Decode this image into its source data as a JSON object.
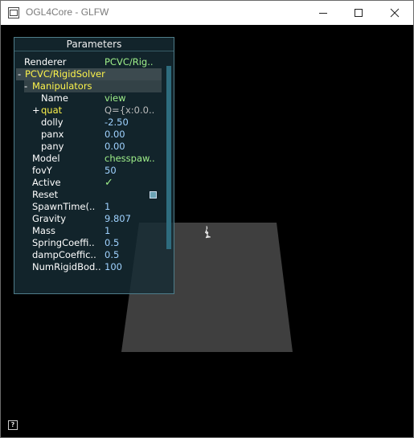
{
  "window": {
    "title": "OGL4Core - GLFW",
    "controls": {
      "minimize_icon": "minimize-icon",
      "maximize_icon": "maximize-icon",
      "close_icon": "close-icon"
    }
  },
  "panel": {
    "title": "Parameters",
    "renderer": {
      "label": "Renderer",
      "value": "PCVC/Rig.."
    },
    "group": {
      "toggle": "-",
      "label": "PCVC/RigidSolver"
    },
    "subgroup": {
      "toggle": "-",
      "label": "Manipulators"
    },
    "manipulators": [
      {
        "toggle": "",
        "label": "Name",
        "value": "view",
        "label_color": "white",
        "value_color": "green"
      },
      {
        "toggle": "+",
        "label": "quat",
        "value": "Q={x:0.0..",
        "label_color": "yellow",
        "value_color": "grey"
      },
      {
        "toggle": "",
        "label": "dolly",
        "value": "-2.50",
        "label_color": "white",
        "value_color": "blue"
      },
      {
        "toggle": "",
        "label": "panx",
        "value": "0.00",
        "label_color": "white",
        "value_color": "blue"
      },
      {
        "toggle": "",
        "label": "pany",
        "value": "0.00",
        "label_color": "white",
        "value_color": "blue"
      }
    ],
    "params": [
      {
        "label": "Model",
        "value": "chesspaw.."
      },
      {
        "label": "fovY",
        "value": "50"
      },
      {
        "label": "Active",
        "value": "✓"
      },
      {
        "label": "Reset",
        "value": ""
      },
      {
        "label": "SpawnTime(..",
        "value": "1"
      },
      {
        "label": "Gravity",
        "value": "9.807"
      },
      {
        "label": "Mass",
        "value": "1"
      },
      {
        "label": "SpringCoeffi..",
        "value": "0.5"
      },
      {
        "label": "dampCoeffic..",
        "value": "0.5"
      },
      {
        "label": "NumRigidBod..",
        "value": "100"
      }
    ]
  },
  "help_button": {
    "label": "?"
  },
  "colors": {
    "panel_bg": "#162c34",
    "value_green": "#9ff08a",
    "value_blue": "#9fd2ff",
    "highlight_yellow": "#fdf34b",
    "floor": "#3f3f3f"
  }
}
